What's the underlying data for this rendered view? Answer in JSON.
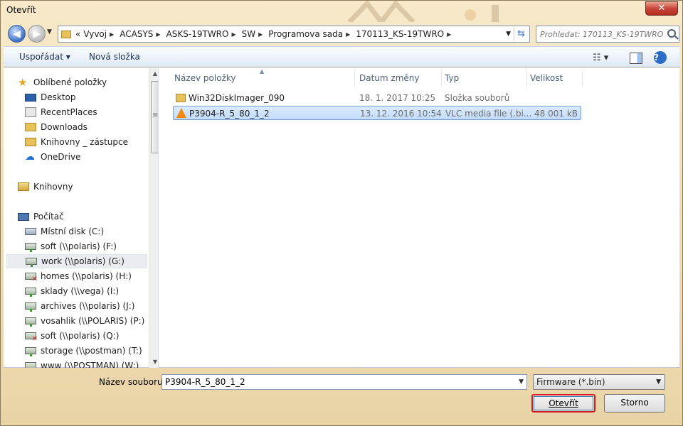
{
  "window": {
    "title": "Otevřít",
    "close_label": "✕"
  },
  "address": {
    "prefix": "«",
    "crumbs": [
      "Vyvoj",
      "ACASYS",
      "ASKS-19TWRO",
      "SW",
      "Programova sada",
      "170113_KS-19TWRO"
    ]
  },
  "search": {
    "placeholder": "Prohledat: 170113_KS-19TWRO"
  },
  "toolbar": {
    "organize": "Uspořádat ▾",
    "new_folder": "Nová složka",
    "help": "?"
  },
  "navpane": {
    "favorites": "Oblíbené položky",
    "fav_items": [
      "Desktop",
      "RecentPlaces",
      "Downloads",
      "Knihovny _ zástupce",
      "OneDrive"
    ],
    "libraries": "Knihovny",
    "computer": "Počítač",
    "drives": [
      "Místní disk (C:)",
      "soft (\\\\polaris) (F:)",
      "work (\\\\polaris) (G:)",
      "homes (\\\\polaris) (H:)",
      "sklady (\\\\vega) (I:)",
      "archives (\\\\polaris) (J:)",
      "vosahlik (\\\\POLARIS) (P:)",
      "soft (\\\\polaris) (Q:)",
      "storage (\\\\postman) (T:)",
      "www (\\\\POSTMAN) (W:)"
    ]
  },
  "columns": {
    "name": "Název položky",
    "date": "Datum změny",
    "type": "Typ",
    "size": "Velikost"
  },
  "files": [
    {
      "name": "Win32DiskImager_090",
      "date": "18. 1. 2017 10:25",
      "type": "Složka souborů",
      "size": ""
    },
    {
      "name": "P3904-R_5_80_1_2",
      "date": "13. 12. 2016 10:54",
      "type": "VLC media file (.bi...",
      "size": "48 001 kB"
    }
  ],
  "bottom": {
    "filename_label": "Název souboru:",
    "filename_value": "P3904-R_5_80_1_2",
    "filter": "Firmware (*.bin)",
    "open": "Otevřít",
    "cancel": "Storno"
  }
}
